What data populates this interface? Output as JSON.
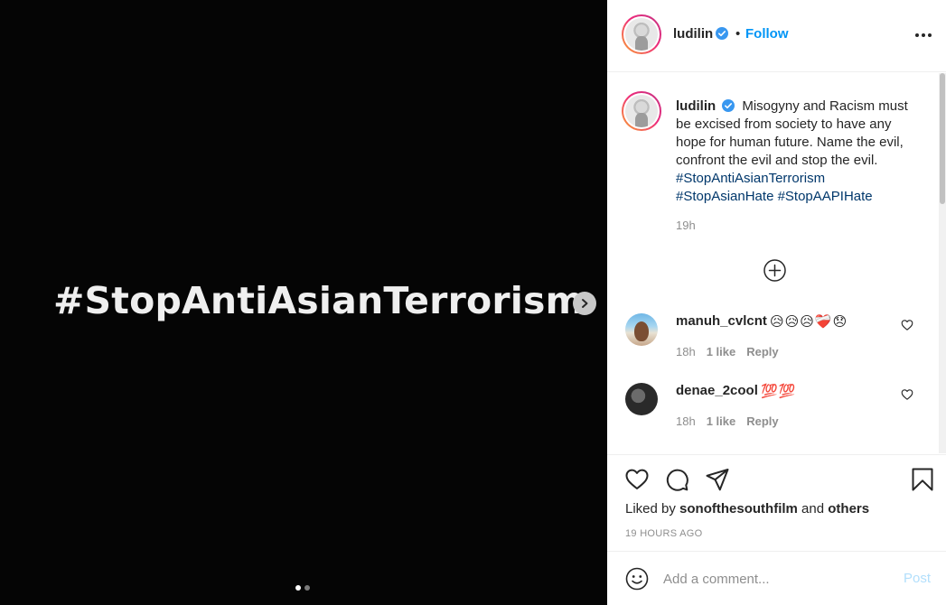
{
  "media": {
    "overlay_text": "#StopAntiAsianTerrorism",
    "slide_count": 2,
    "active_slide": 1
  },
  "header": {
    "username": "ludilin",
    "separator": "•",
    "follow_label": "Follow"
  },
  "caption": {
    "username": "ludilin",
    "text": "Misogyny and Racism must be excised from society to have any hope for human future. Name the evil, confront the evil and stop the evil.",
    "hashtags": [
      "#StopAntiAsianTerrorism",
      "#StopAsianHate",
      "#StopAAPIHate"
    ],
    "time": "19h"
  },
  "comments": [
    {
      "username": "manuh_cvlcnt",
      "text": "😥😥😥❤️‍🩹😞",
      "time": "18h",
      "likes": "1 like",
      "reply_label": "Reply"
    },
    {
      "username": "denae_2cool",
      "text": "💯💯",
      "time": "18h",
      "likes": "1 like",
      "reply_label": "Reply"
    }
  ],
  "likes": {
    "prefix": "Liked by",
    "user": "sonofthesouthfilm",
    "conjunction": "and",
    "others": "others"
  },
  "post_time": "19 HOURS AGO",
  "comment_box": {
    "placeholder": "Add a comment...",
    "post_label": "Post"
  },
  "colors": {
    "accent": "#0095f6",
    "hashtag": "#00376b",
    "muted": "#8e8e8e",
    "post_disabled": "#b2dffc"
  }
}
